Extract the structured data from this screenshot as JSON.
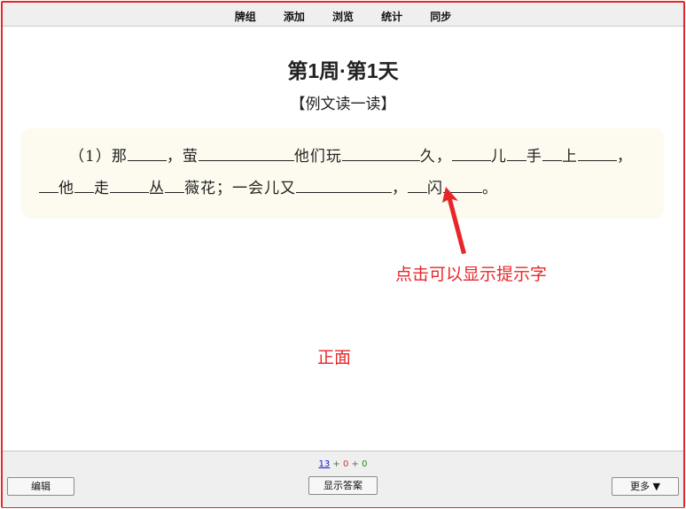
{
  "top_menu": [
    "牌组",
    "添加",
    "浏览",
    "统计",
    "同步"
  ],
  "card": {
    "title": "第1周·第1天",
    "subtitle": "【例文读一读】",
    "segments": [
      {
        "t": "（1）那"
      },
      {
        "b": 44
      },
      {
        "t": "，萤"
      },
      {
        "b": 108
      },
      {
        "t": "他们玩"
      },
      {
        "b": 88
      },
      {
        "t": "久，"
      },
      {
        "b": 44
      },
      {
        "t": "儿"
      },
      {
        "b": 22
      },
      {
        "t": "手"
      },
      {
        "b": 22
      },
      {
        "t": "上"
      },
      {
        "b": 44
      },
      {
        "t": "，"
      },
      {
        "b": 22
      },
      {
        "t": "他"
      },
      {
        "b": 22
      },
      {
        "t": "走"
      },
      {
        "b": 44
      },
      {
        "t": "丛"
      },
      {
        "b": 22
      },
      {
        "t": "薇花；一会儿又"
      },
      {
        "b": 108
      },
      {
        "t": "，"
      },
      {
        "b": 22
      },
      {
        "t": "闪"
      },
      {
        "b": 44
      },
      {
        "t": "。"
      }
    ]
  },
  "annotations": {
    "hint": "点击可以显示提示字",
    "front": "正面"
  },
  "bottom": {
    "counts": {
      "new": "13",
      "plus1": " + ",
      "learn": "0",
      "plus2": " + ",
      "review": "0"
    },
    "edit": "编辑",
    "show_answer": "显示答案",
    "more": "更多 ▼"
  },
  "colors": {
    "accent_red": "#e8262a",
    "card_bg": "#fdfaf0"
  }
}
